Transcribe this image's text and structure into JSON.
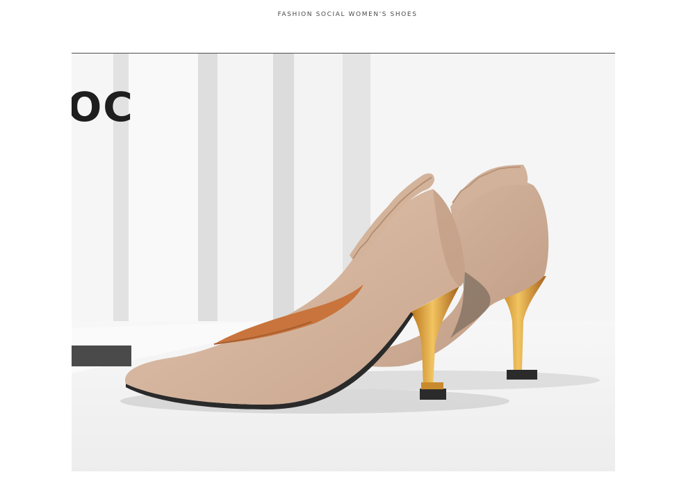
{
  "header": {
    "title": "FASHION SOCIAL WOMEN'S SHOES"
  },
  "photo": {
    "logo_text": "OC",
    "colors": {
      "suede": "#d7b8a2",
      "suede_shadow": "#bf9e87",
      "lining": "#c8743c",
      "heel_gold": "#e0a53a",
      "heel_tip": "#2b2b2b",
      "background": "#f1f1f1"
    }
  }
}
